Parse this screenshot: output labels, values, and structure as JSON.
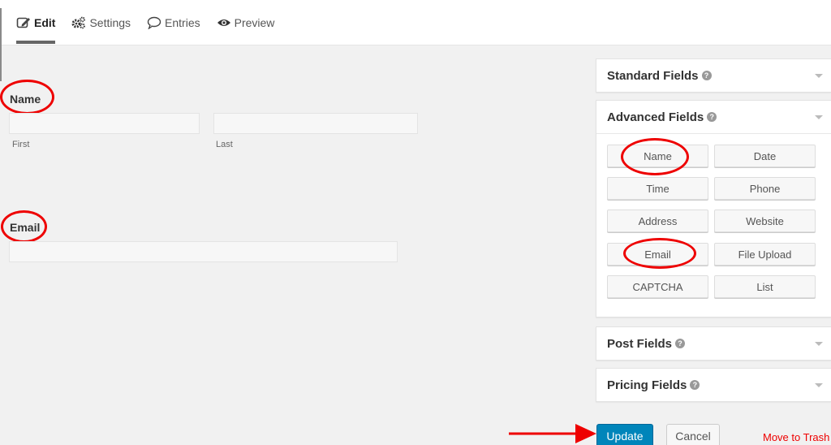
{
  "tabs": [
    {
      "label": "Edit",
      "icon": "edit-icon",
      "active": true
    },
    {
      "label": "Settings",
      "icon": "gears-icon",
      "active": false
    },
    {
      "label": "Entries",
      "icon": "speech-bubble-icon",
      "active": false
    },
    {
      "label": "Preview",
      "icon": "eye-icon",
      "active": false
    }
  ],
  "form": {
    "name_field": {
      "label": "Name",
      "first_sublabel": "First",
      "last_sublabel": "Last",
      "first_value": "",
      "last_value": ""
    },
    "email_field": {
      "label": "Email",
      "value": ""
    }
  },
  "sidebar": {
    "help_glyph": "?",
    "panels": [
      {
        "title": "Standard Fields",
        "expanded": false
      },
      {
        "title": "Advanced Fields",
        "expanded": true
      },
      {
        "title": "Post Fields",
        "expanded": false
      },
      {
        "title": "Pricing Fields",
        "expanded": false
      }
    ],
    "advanced_buttons": [
      "Name",
      "Date",
      "Time",
      "Phone",
      "Address",
      "Website",
      "Email",
      "File Upload",
      "CAPTCHA",
      "List"
    ]
  },
  "actions": {
    "update_label": "Update",
    "cancel_label": "Cancel",
    "trash_label": "Move to Trash"
  },
  "annotations": {
    "highlight_color": "#ee0000",
    "accent_color": "#0085ba"
  }
}
